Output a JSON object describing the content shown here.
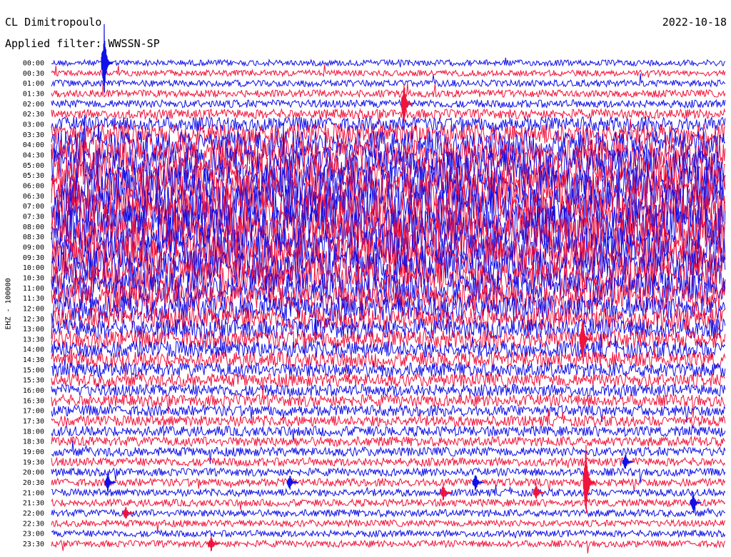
{
  "header": {
    "station": "CL Dimitropoulo",
    "date": "2022-10-18",
    "filter": "Applied filter: WWSSN-SP"
  },
  "channel_label": "EHZ - 100000",
  "colors": {
    "trace_a": "#1010e8",
    "trace_b": "#f0143c",
    "text": "#000000",
    "background": "#ffffff"
  },
  "chart_data": {
    "type": "line",
    "subtype": "helicorder",
    "hour_labels": [
      "00:00",
      "00:30",
      "01:00",
      "01:30",
      "02:00",
      "02:30",
      "03:00",
      "03:30",
      "04:00",
      "04:30",
      "05:00",
      "05:30",
      "06:00",
      "06:30",
      "07:00",
      "07:30",
      "08:00",
      "08:30",
      "09:00",
      "09:30",
      "10:00",
      "10:30",
      "11:00",
      "11:30",
      "12:00",
      "12:30",
      "13:00",
      "13:30",
      "14:00",
      "14:30",
      "15:00",
      "15:30",
      "16:00",
      "16:30",
      "17:00",
      "17:30",
      "18:00",
      "18:30",
      "19:00",
      "19:30",
      "20:00",
      "20:30",
      "21:00",
      "21:30",
      "22:00",
      "22:30",
      "23:00",
      "23:30"
    ],
    "trace_minutes": 30,
    "color_sequence": [
      "trace_a",
      "trace_b"
    ],
    "amplitude_profile": [
      1.0,
      1.0,
      1.1,
      1.2,
      1.3,
      1.6,
      2.4,
      3.6,
      4.6,
      5.2,
      5.8,
      6.2,
      6.6,
      7.0,
      7.2,
      7.2,
      7.2,
      7.0,
      6.6,
      6.2,
      5.8,
      5.4,
      5.0,
      4.6,
      4.2,
      3.8,
      3.4,
      3.0,
      2.8,
      2.6,
      2.4,
      2.2,
      2.0,
      2.0,
      1.8,
      1.8,
      1.7,
      1.6,
      1.5,
      1.4,
      1.3,
      1.3,
      1.2,
      1.2,
      1.2,
      1.1,
      1.1,
      1.1
    ]
  }
}
